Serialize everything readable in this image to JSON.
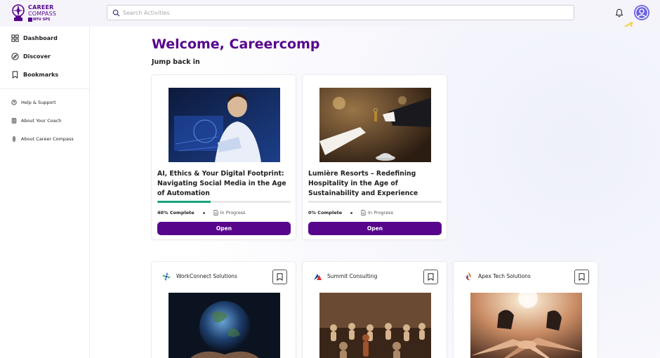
{
  "brand": {
    "line1": "CAREER",
    "line2": "COMPASS",
    "badge": "NYU SPS",
    "color": "#57068c"
  },
  "search": {
    "placeholder": "Search Activities",
    "value": ""
  },
  "header_icons": [
    "search-icon",
    "bell-icon",
    "user-avatar-icon"
  ],
  "sidebar": {
    "items": [
      {
        "label": "Dashboard",
        "icon": "dashboard-grid-icon"
      },
      {
        "label": "Discover",
        "icon": "compass-icon"
      },
      {
        "label": "Bookmarks",
        "icon": "bookmark-icon"
      }
    ],
    "secondary": [
      {
        "label": "Help & Support",
        "icon": "help-icon"
      },
      {
        "label": "About Your Coach",
        "icon": "coach-icon"
      },
      {
        "label": "About Career Compass",
        "icon": "info-icon"
      }
    ]
  },
  "main": {
    "welcome": "Welcome, Careercomp",
    "section_title": "Jump back in",
    "courses": [
      {
        "title": "AI, Ethics & Your Digital Footprint: Navigating Social Media in the Age of Automation",
        "progress": 0.4,
        "progress_label": "40% Complete",
        "status": "In Progress",
        "button": "Open"
      },
      {
        "title": "Lumière Resorts – Redefining Hospitality in the Age of Sustainability and Experience",
        "progress": 0.0,
        "progress_label": "0% Complete",
        "status": "In Progress",
        "button": "Open"
      }
    ],
    "companies": [
      {
        "name": "WorkConnect Solutions",
        "icon": "bookmark-icon"
      },
      {
        "name": "Summit Consulting",
        "icon": "bookmark-icon"
      },
      {
        "name": "Apex Tech Solutions",
        "icon": "bookmark-icon"
      }
    ]
  },
  "colors": {
    "accent": "#57068c",
    "progress": "#17a47c",
    "avatar": "#6b63e0",
    "arrow": "#f0d54a"
  }
}
